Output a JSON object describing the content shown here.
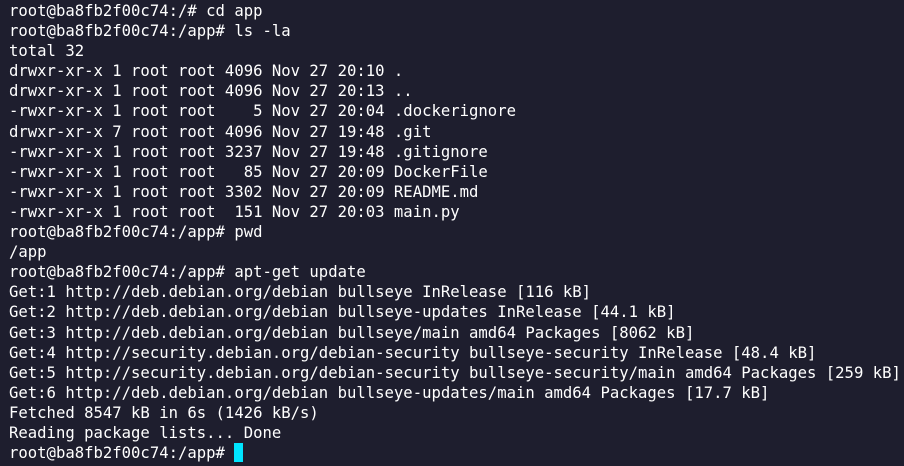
{
  "terminal": {
    "background": "#1e1e2e",
    "foreground": "#ffffff",
    "cursor_color": "#00e5ff",
    "lines": [
      "root@ba8fb2f00c74:/# cd app",
      "root@ba8fb2f00c74:/app# ls -la",
      "total 32",
      "drwxr-xr-x 1 root root 4096 Nov 27 20:10 .",
      "drwxr-xr-x 1 root root 4096 Nov 27 20:13 ..",
      "-rwxr-xr-x 1 root root    5 Nov 27 20:04 .dockerignore",
      "drwxr-xr-x 7 root root 4096 Nov 27 19:48 .git",
      "-rwxr-xr-x 1 root root 3237 Nov 27 19:48 .gitignore",
      "-rwxr-xr-x 1 root root   85 Nov 27 20:09 DockerFile",
      "-rwxr-xr-x 1 root root 3302 Nov 27 20:09 README.md",
      "-rwxr-xr-x 1 root root  151 Nov 27 20:03 main.py",
      "root@ba8fb2f00c74:/app# pwd",
      "/app",
      "root@ba8fb2f00c74:/app# apt-get update",
      "Get:1 http://deb.debian.org/debian bullseye InRelease [116 kB]",
      "Get:2 http://deb.debian.org/debian bullseye-updates InRelease [44.1 kB]",
      "Get:3 http://deb.debian.org/debian bullseye/main amd64 Packages [8062 kB]",
      "Get:4 http://security.debian.org/debian-security bullseye-security InRelease [48.4 kB]",
      "Get:5 http://security.debian.org/debian-security bullseye-security/main amd64 Packages [259 kB]",
      "Get:6 http://deb.debian.org/debian bullseye-updates/main amd64 Packages [17.7 kB]",
      "Fetched 8547 kB in 6s (1426 kB/s)",
      "Reading package lists... Done"
    ],
    "prompt": "root@ba8fb2f00c74:/app# "
  }
}
